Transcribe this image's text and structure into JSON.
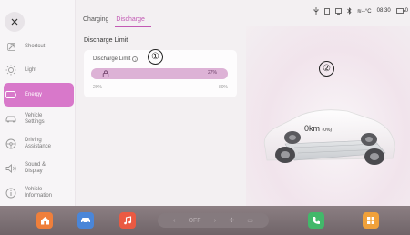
{
  "sidebar": {
    "close_icon": "close-icon",
    "items": [
      {
        "label": "Shortcut",
        "icon": "shortcut-icon",
        "active": false
      },
      {
        "label": "Light",
        "icon": "light-icon",
        "active": false
      },
      {
        "label": "Energy",
        "icon": "battery-icon",
        "active": true
      },
      {
        "label": "Vehicle\nSettings",
        "icon": "car-icon",
        "active": false
      },
      {
        "label": "Driving\nAssistance",
        "icon": "steering-icon",
        "active": false
      },
      {
        "label": "Sound &\nDisplay",
        "icon": "speaker-icon",
        "active": false
      },
      {
        "label": "Vehicle\nInformation",
        "icon": "info-icon",
        "active": false
      }
    ]
  },
  "tabs": [
    {
      "label": "Charging",
      "active": false
    },
    {
      "label": "Discharge",
      "active": true
    }
  ],
  "section_title": "Discharge Limit",
  "limit_card": {
    "label": "Discharge Limit",
    "value_label": "27%",
    "value_percent": 27,
    "min_label": "20%",
    "max_label": "80%"
  },
  "callouts": [
    "①",
    "②"
  ],
  "status_bar": {
    "time": "08:30",
    "temperature": "--°C",
    "battery_partial": "0"
  },
  "vehicle": {
    "range_value": "0km",
    "range_percent": "(0%)"
  },
  "dock": {
    "climate_label": "OFF",
    "items": [
      "home-icon",
      "car-icon",
      "music-icon",
      "phone-icon",
      "apps-icon"
    ]
  },
  "colors": {
    "accent": "#c25ab4",
    "active_bg": "#d878ca",
    "slider_fill": "#ddb2d6",
    "home": "#ef7f3b",
    "car": "#4a86d8",
    "music": "#ea5a42",
    "phone": "#42b86a",
    "apps": "#f0a13a"
  }
}
